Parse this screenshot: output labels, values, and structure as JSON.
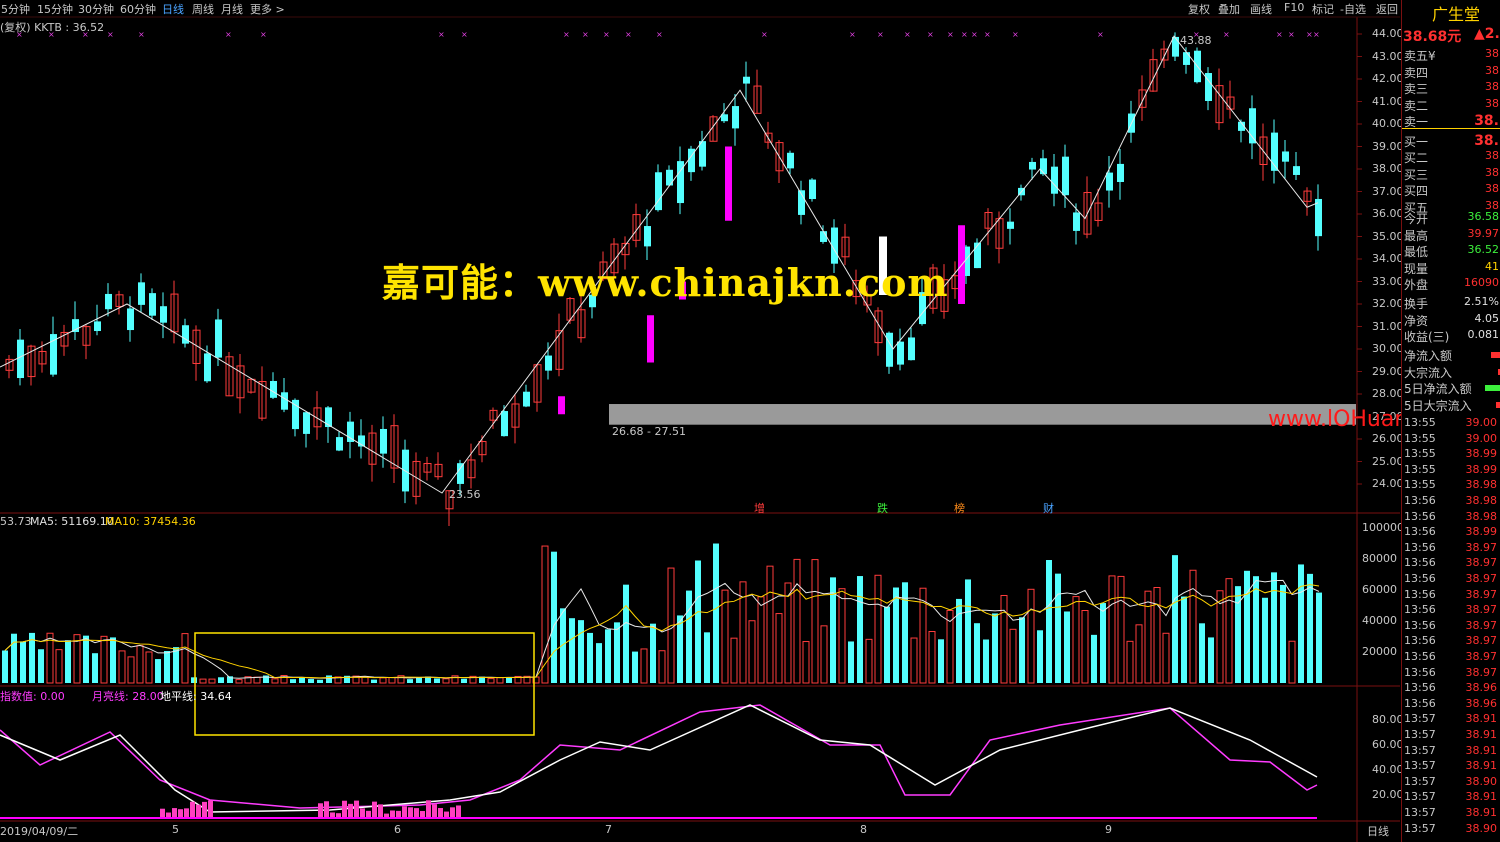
{
  "toolbar": {
    "periods": [
      "5分钟",
      "15分钟",
      "30分钟",
      "60分钟",
      "日线",
      "周线",
      "月线",
      "更多 >"
    ],
    "active": "日线",
    "right_tools": [
      "复权",
      "叠加",
      "画线",
      "F10",
      "标记",
      "-自选",
      "返回"
    ]
  },
  "main_chart": {
    "info": "(复权) KKTB : 36.52",
    "price_axis": [
      "44.00",
      "43.00",
      "42.00",
      "41.00",
      "40.00",
      "39.00",
      "38.00",
      "37.00",
      "36.00",
      "35.00",
      "34.00",
      "33.00",
      "32.00",
      "31.00",
      "30.00",
      "29.00",
      "28.00",
      "27.00",
      "26.00",
      "25.00",
      "24.00"
    ],
    "annotations": {
      "high": "43.88",
      "low": "23.56",
      "band": "26.68 - 27.51"
    },
    "events": [
      "增",
      "跌",
      "榜",
      "财"
    ]
  },
  "watermarks": {
    "main": "嘉可能：www.chinajkn.com",
    "corner": "www.lOHuang.CN"
  },
  "volume": {
    "info": "53.73",
    "ma5": "MA5: 51169.10",
    "ma10": "MA10: 37454.36",
    "axis": [
      "100000",
      "80000",
      "60000",
      "40000",
      "20000"
    ]
  },
  "indicator": {
    "l1": "指数值: 0.00",
    "l2": "月亮线: 28.00",
    "l3": "地平线: 34.64",
    "axis": [
      "80.00",
      "60.00",
      "40.00",
      "20.00"
    ]
  },
  "date_axis": {
    "start": "2019/04/09/二",
    "months": [
      "5",
      "6",
      "7",
      "8",
      "9"
    ],
    "period_label": "日线"
  },
  "panel": {
    "name": "广生堂",
    "price": "38.68元",
    "change": "▲2.",
    "orderbook": [
      {
        "label": "卖五",
        "value": "38",
        "extra": "¥"
      },
      {
        "label": "卖四",
        "value": "38"
      },
      {
        "label": "卖三",
        "value": "38"
      },
      {
        "label": "卖二",
        "value": "38"
      },
      {
        "label": "卖一",
        "value": "38."
      },
      {
        "label": "买一",
        "value": "38."
      },
      {
        "label": "买二",
        "value": "38"
      },
      {
        "label": "买三",
        "value": "38"
      },
      {
        "label": "买四",
        "value": "38"
      },
      {
        "label": "买五",
        "value": "38"
      }
    ],
    "stats": [
      {
        "label": "今开",
        "value": "36.58",
        "color": "#3cf03c"
      },
      {
        "label": "最高",
        "value": "39.97",
        "color": "#ff3030"
      },
      {
        "label": "最低",
        "value": "36.52",
        "color": "#3cf03c"
      },
      {
        "label": "现量",
        "value": "41",
        "color": "#ffd200"
      },
      {
        "label": "外盘",
        "value": "16090",
        "color": "#ff3030"
      },
      {
        "label": "换手",
        "value": "2.51%",
        "color": "#e0e0e0"
      },
      {
        "label": "净资",
        "value": "4.05",
        "color": "#e0e0e0"
      },
      {
        "label": "收益(三)",
        "value": "0.081",
        "color": "#e0e0e0"
      }
    ],
    "flows": [
      "净流入额",
      "大宗流入",
      "5日净流入额",
      "5日大宗流入"
    ],
    "ticks": [
      {
        "t": "13:55",
        "v": "39.00"
      },
      {
        "t": "13:55",
        "v": "39.00"
      },
      {
        "t": "13:55",
        "v": "38.99"
      },
      {
        "t": "13:55",
        "v": "38.99"
      },
      {
        "t": "13:55",
        "v": "38.98"
      },
      {
        "t": "13:56",
        "v": "38.98"
      },
      {
        "t": "13:56",
        "v": "38.98"
      },
      {
        "t": "13:56",
        "v": "38.99"
      },
      {
        "t": "13:56",
        "v": "38.97"
      },
      {
        "t": "13:56",
        "v": "38.97"
      },
      {
        "t": "13:56",
        "v": "38.97"
      },
      {
        "t": "13:56",
        "v": "38.97"
      },
      {
        "t": "13:56",
        "v": "38.97"
      },
      {
        "t": "13:56",
        "v": "38.97"
      },
      {
        "t": "13:56",
        "v": "38.97"
      },
      {
        "t": "13:56",
        "v": "38.97"
      },
      {
        "t": "13:56",
        "v": "38.97"
      },
      {
        "t": "13:56",
        "v": "38.96"
      },
      {
        "t": "13:56",
        "v": "38.96"
      },
      {
        "t": "13:57",
        "v": "38.91"
      },
      {
        "t": "13:57",
        "v": "38.91"
      },
      {
        "t": "13:57",
        "v": "38.91"
      },
      {
        "t": "13:57",
        "v": "38.91"
      },
      {
        "t": "13:57",
        "v": "38.90"
      },
      {
        "t": "13:57",
        "v": "38.91"
      },
      {
        "t": "13:57",
        "v": "38.91"
      },
      {
        "t": "13:57",
        "v": "38.90"
      }
    ]
  },
  "colors": {
    "up": "#ff3c3c",
    "down": "#54ffff",
    "magenta": "#ff00ff",
    "white": "#ffffff",
    "yellow": "#ffd200"
  }
}
